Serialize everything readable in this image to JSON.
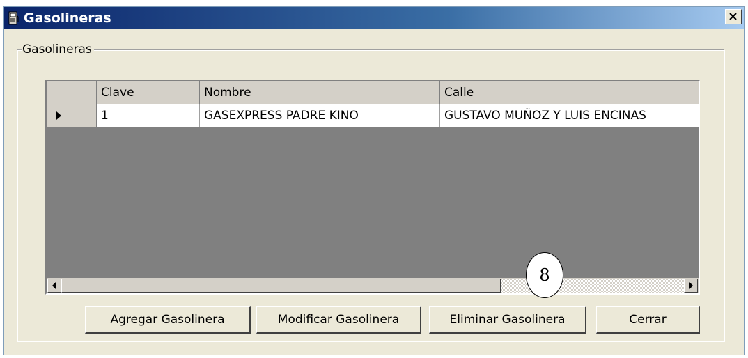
{
  "window": {
    "title": "Gasolineras",
    "close_symbol": "×"
  },
  "groupbox": {
    "label": "Gasolineras"
  },
  "grid": {
    "columns": [
      "Clave",
      "Nombre",
      "Calle"
    ],
    "rows": [
      [
        "1",
        "GASEXPRESS PADRE KINO",
        "GUSTAVO MUÑOZ Y LUIS ENCINAS"
      ]
    ],
    "row_indicator": "▶"
  },
  "scrollbar": {
    "left_arrow": "◀",
    "right_arrow": "▶"
  },
  "callout": {
    "label": "8"
  },
  "buttons": {
    "add": "Agregar Gasolinera",
    "modify": "Modificar Gasolinera",
    "delete": "Eliminar Gasolinera",
    "close": "Cerrar"
  },
  "colors": {
    "titlebar_start": "#0a246a",
    "titlebar_end": "#a6caf0",
    "window_bg": "#ece9d8",
    "grid_bg": "#808080"
  },
  "icons": {
    "title": "gas-pump-icon",
    "close": "close-icon",
    "row_indicator": "row-selector-arrow-icon",
    "scroll_left": "arrow-left-icon",
    "scroll_right": "arrow-right-icon"
  }
}
